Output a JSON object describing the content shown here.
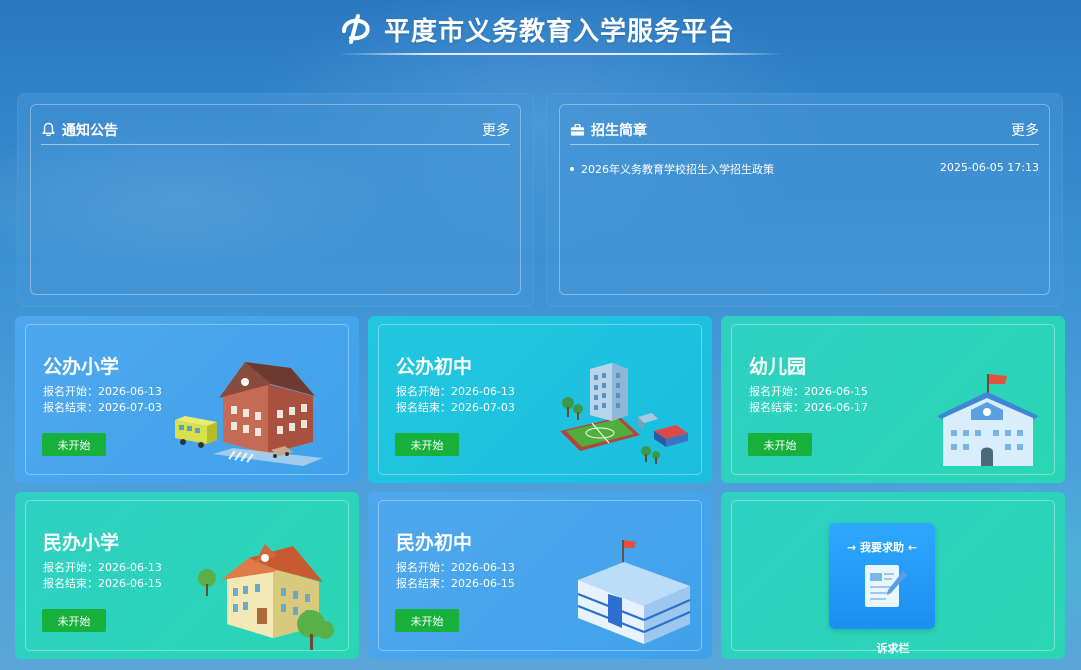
{
  "header": {
    "title": "平度市义务教育入学服务平台",
    "logo_icon": "logo-icon"
  },
  "notices": {
    "title": "通知公告",
    "more": "更多",
    "icon": "bell-icon",
    "items": []
  },
  "admissions": {
    "title": "招生简章",
    "more": "更多",
    "icon": "briefcase-icon",
    "items": [
      {
        "text": "2026年义务教育学校招生入学招生政策",
        "date": "2025-06-05 17:13"
      }
    ]
  },
  "cards": [
    {
      "title": "公办小学",
      "start": "报名开始：2026-06-13",
      "end": "报名结束：2026-07-03",
      "status": "未开始",
      "icon": "school-building-bus-icon"
    },
    {
      "title": "公办初中",
      "start": "报名开始：2026-06-13",
      "end": "报名结束：2026-07-03",
      "status": "未开始",
      "icon": "school-sports-field-icon"
    },
    {
      "title": "幼儿园",
      "start": "报名开始：2026-06-15",
      "end": "报名结束：2026-06-17",
      "status": "未开始",
      "icon": "kindergarten-building-icon"
    },
    {
      "title": "民办小学",
      "start": "报名开始：2026-06-13",
      "end": "报名结束：2026-06-15",
      "status": "未开始",
      "icon": "private-school-building-icon"
    },
    {
      "title": "民办初中",
      "start": "报名开始：2026-06-13",
      "end": "报名结束：2026-06-15",
      "status": "未开始",
      "icon": "middle-school-building-icon"
    }
  ],
  "help": {
    "title": "→ 我要求助 ←",
    "caption": "诉求栏",
    "icon": "help-document-icon"
  },
  "colors": {
    "status_green": "#16b03a",
    "card_blue": "#46a5ec",
    "card_cyan": "#1ec2df",
    "card_green": "#2cd3bb"
  }
}
